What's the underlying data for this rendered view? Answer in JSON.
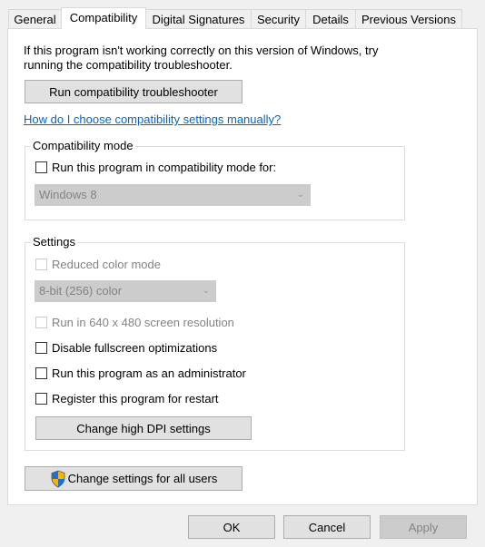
{
  "tabs": [
    {
      "label": "General"
    },
    {
      "label": "Compatibility",
      "selected": true
    },
    {
      "label": "Digital Signatures"
    },
    {
      "label": "Security"
    },
    {
      "label": "Details"
    },
    {
      "label": "Previous Versions"
    }
  ],
  "intro": {
    "line1": "If this program isn't working correctly on this version of Windows, try",
    "line2": "running the compatibility troubleshooter."
  },
  "troubleshooter_button": "Run compatibility troubleshooter",
  "help_link": "How do I choose compatibility settings manually?",
  "compat_mode": {
    "title": "Compatibility mode",
    "checkbox": "Run this program in compatibility mode for:",
    "checked": false,
    "dropdown_value": "Windows 8"
  },
  "settings": {
    "title": "Settings",
    "reduced_color": {
      "label": "Reduced color mode",
      "checked": false,
      "disabled": true
    },
    "color_dropdown": "8-bit (256) color",
    "res640": {
      "label": "Run in 640 x 480 screen resolution",
      "checked": false,
      "disabled": true
    },
    "fullscreen": {
      "label": "Disable fullscreen optimizations",
      "checked": false
    },
    "admin": {
      "label": "Run this program as an administrator",
      "checked": false
    },
    "restart": {
      "label": "Register this program for restart",
      "checked": false
    },
    "dpi_button": "Change high DPI settings"
  },
  "all_users_button": "Change settings for all users",
  "footer": {
    "ok": "OK",
    "cancel": "Cancel",
    "apply": "Apply"
  },
  "colors": {
    "link": "#0066cc",
    "shield_blue": "#1f6fd1",
    "shield_yellow": "#f7b500"
  }
}
